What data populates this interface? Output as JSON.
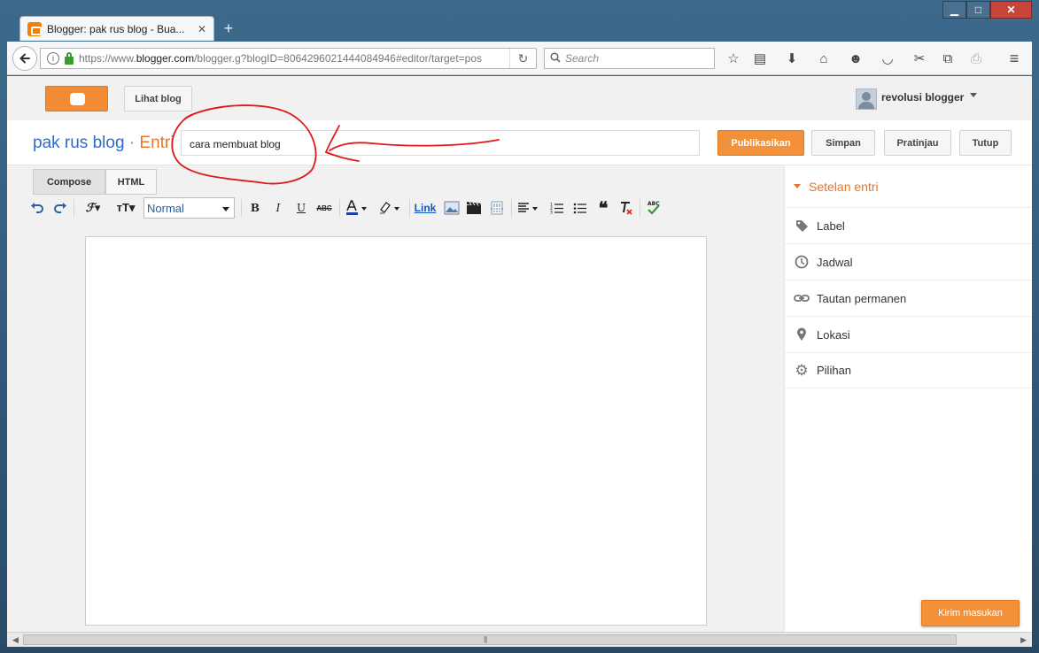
{
  "window": {
    "minimize": "▁",
    "maximize": "□",
    "close": "✕"
  },
  "browser": {
    "tab_title": "Blogger: pak rus blog - Bua...",
    "tab_close": "✕",
    "new_tab": "+",
    "url_prefix": "https://www.",
    "url_domain": "blogger.com",
    "url_rest": "/blogger.g?blogID=8064296021444084946#editor/target=pos",
    "search_placeholder": "Search",
    "toolbar_icons": [
      "star-icon",
      "reading-list-icon",
      "download-icon",
      "home-icon",
      "emoji-icon",
      "pocket-icon",
      "scissors-icon",
      "translate-icon",
      "clipboard-icon",
      "menu-icon"
    ]
  },
  "topbar": {
    "view_blog": "Lihat blog",
    "username": "revolusi blogger"
  },
  "title_row": {
    "blog_name": "pak rus blog",
    "separator": " · ",
    "section": "Entri",
    "post_title": "cara membuat blog",
    "publish": "Publikasikan",
    "save": "Simpan",
    "preview": "Pratinjau",
    "close": "Tutup"
  },
  "editor": {
    "mode_compose": "Compose",
    "mode_html": "HTML",
    "format_value": "Normal",
    "link_label": "Link",
    "bold": "B",
    "italic": "I",
    "underline": "U",
    "strike": "ABC"
  },
  "sidebar": {
    "heading": "Setelan entri",
    "items": [
      {
        "label": "Label",
        "icon": "tag-icon"
      },
      {
        "label": "Jadwal",
        "icon": "clock-icon"
      },
      {
        "label": "Tautan permanen",
        "icon": "link-icon"
      },
      {
        "label": "Lokasi",
        "icon": "location-pin-icon"
      },
      {
        "label": "Pilihan",
        "icon": "gear-icon"
      }
    ]
  },
  "feedback": "Kirim masukan",
  "colors": {
    "accent_orange": "#f3913b",
    "blog_blue": "#2d6bd2",
    "annotation_red": "#e0181b"
  }
}
